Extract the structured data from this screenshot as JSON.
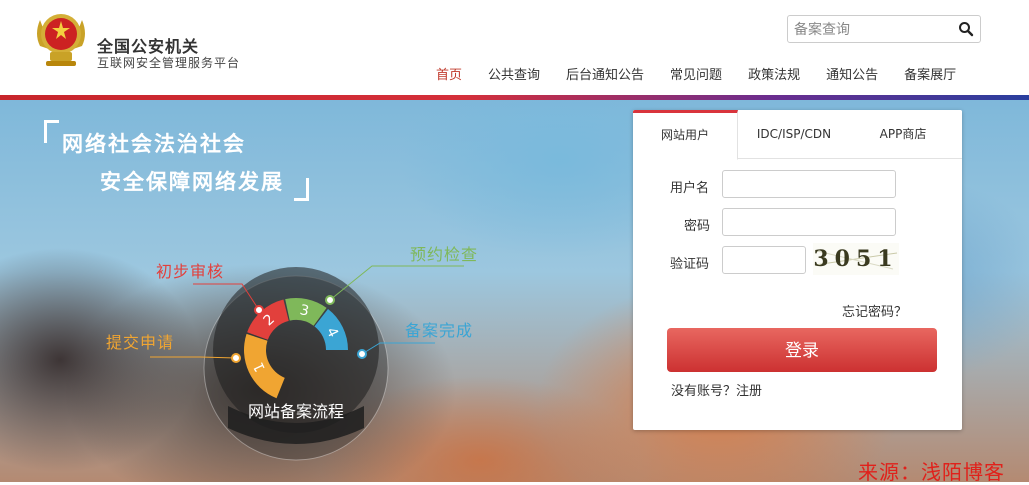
{
  "header": {
    "title": "全国公安机关",
    "subtitle": "互联网安全管理服务平台",
    "search": {
      "placeholder": "备案查询"
    },
    "nav": [
      {
        "label": "首页",
        "active": true
      },
      {
        "label": "公共查询"
      },
      {
        "label": "后台通知公告"
      },
      {
        "label": "常见问题"
      },
      {
        "label": "政策法规"
      },
      {
        "label": "通知公告"
      },
      {
        "label": "备案展厅"
      }
    ]
  },
  "hero": {
    "slogan_line1": "网络社会法治社会",
    "slogan_line2": "安全保障网络发展",
    "flow": {
      "center_label": "网站备案流程",
      "steps": [
        {
          "number": "1",
          "label": "提交申请",
          "color": "#f0a532"
        },
        {
          "number": "2",
          "label": "初步审核",
          "color": "#e2403c"
        },
        {
          "number": "3",
          "label": "预约检查",
          "color": "#7fb85a"
        },
        {
          "number": "4",
          "label": "备案完成",
          "color": "#3ba5d4"
        }
      ]
    }
  },
  "login": {
    "tabs": [
      {
        "label": "网站用户",
        "active": true
      },
      {
        "label": "IDC/ISP/CDN"
      },
      {
        "label": "APP商店"
      }
    ],
    "username_label": "用户名",
    "password_label": "密码",
    "captcha_label": "验证码",
    "captcha_text": "3051",
    "forgot_password": "忘记密码？",
    "login_button": "登录",
    "register_link": "没有账号？注册"
  },
  "watermark": "来源：浅陌博客",
  "colors": {
    "accent": "#d9343c",
    "nav_active": "#c0392b"
  }
}
